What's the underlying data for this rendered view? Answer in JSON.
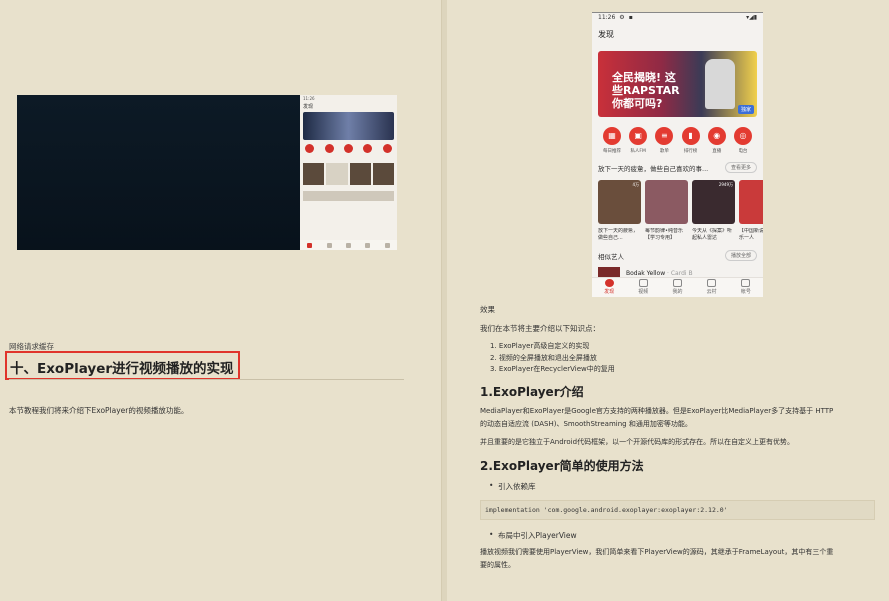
{
  "left": {
    "video_phone": {
      "status": "11:26",
      "title": "发现"
    },
    "caption": "网络请求缓存",
    "heading": "十、ExoPlayer进行视频播放的实现",
    "paragraph": "本节教程我们将来介绍下ExoPlayer的视频播放功能。"
  },
  "phone": {
    "time": "11:26",
    "title": "发现",
    "banner_slogan": "全民揭晓! 这些RAPSTAR你都可吗?",
    "banner_tag": "独家",
    "icons": [
      {
        "label": "每日推荐",
        "glyph": "▦"
      },
      {
        "label": "私人FM",
        "glyph": "▣"
      },
      {
        "label": "歌单",
        "glyph": "≡"
      },
      {
        "label": "排行榜",
        "glyph": "▮"
      },
      {
        "label": "直播",
        "glyph": "◉"
      },
      {
        "label": "电台",
        "glyph": "◎"
      }
    ],
    "section1_title": "放下一天的疲惫，做些自己喜欢的事...",
    "section1_more": "查看更多",
    "cards": [
      {
        "caption": "放下一天的疲惫，做些自己...",
        "count": "4万"
      },
      {
        "caption": "每节韵律•纯音乐【学习专用】",
        "count": ""
      },
      {
        "caption": "今天从《探案》听起私人雷达",
        "count": "2949万"
      },
      {
        "caption": "【中国新说唱】音乐一人",
        "count": ""
      }
    ],
    "section2_title": "相似艺人",
    "section2_more": "播放全部",
    "artist_name": "Bodak Yellow",
    "artist_sub": " · Cardi B",
    "nav": [
      "发现",
      "视频",
      "我的",
      "云村",
      "帐号"
    ]
  },
  "right": {
    "effect": "效果",
    "intro": "我们在本节将主要介绍以下知识点：",
    "points": [
      "1. ExoPlayer高级自定义的实现",
      "2. 视频的全屏播放和退出全屏播放",
      "3. ExoPlayer在RecyclerView中的复用"
    ],
    "h1": "1.ExoPlayer介绍",
    "p1a": "MediaPlayer和ExoPlayer是Google官方支持的两种播放器。但是ExoPlayer比MediaPlayer多了支持基于 HTTP",
    "p1b": "的动态自适应流 (DASH)、SmoothStreaming 和通用加密等功能。",
    "p2": "并且重要的是它独立于Android代码框架，以一个开源代码库的形式存在。所以在自定义上更有优势。",
    "h2": "2.ExoPlayer简单的使用方法",
    "bullet1": "引入依赖库",
    "code": "implementation 'com.google.android.exoplayer:exoplayer:2.12.0'",
    "bullet2": "布局中引入PlayerView",
    "p3a": "播放视频我们需要使用PlayerView，我们简单来看下PlayerView的源码，其继承于FrameLayout，其中有三个重",
    "p3b": "要的属性。"
  }
}
